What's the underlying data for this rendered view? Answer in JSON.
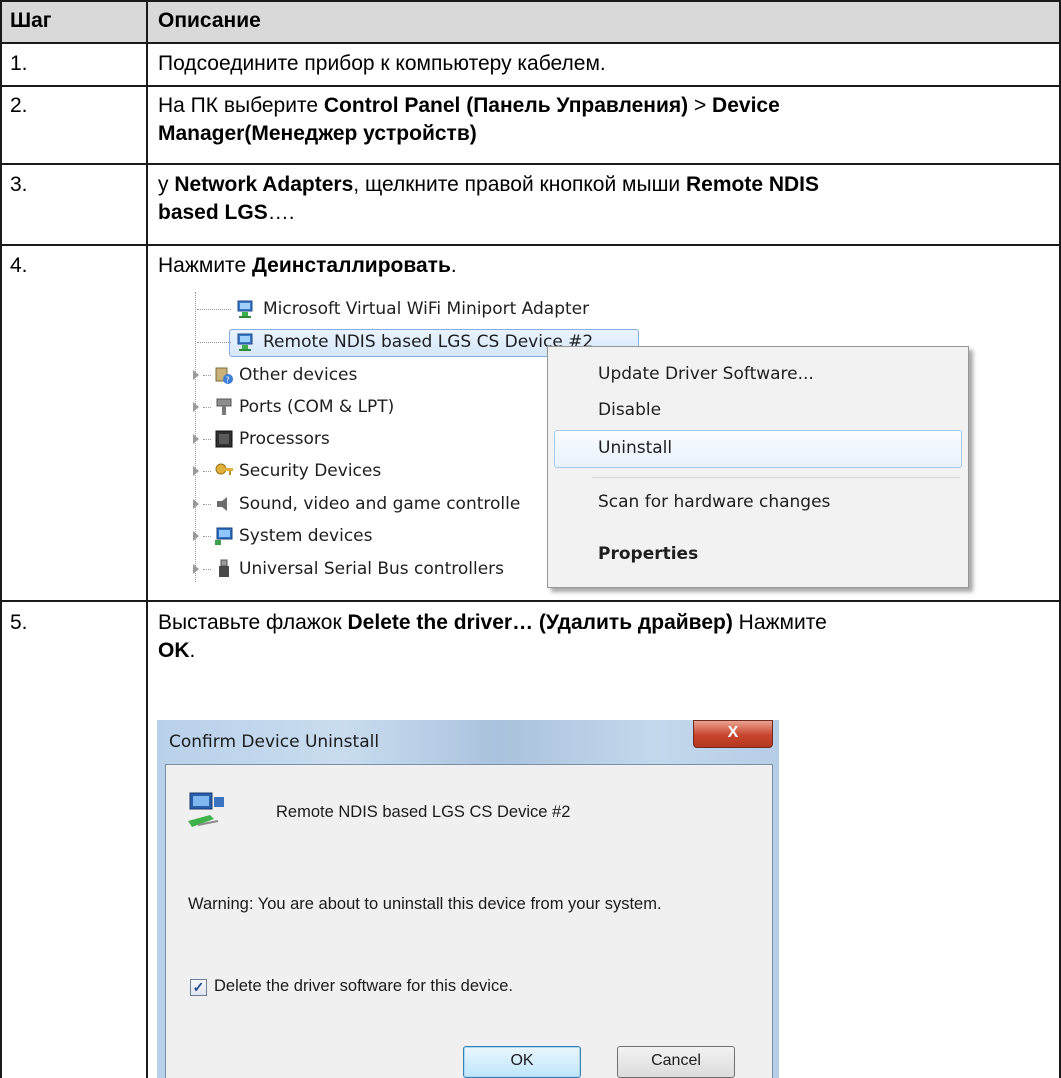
{
  "header": {
    "step": "Шаг",
    "description": "Описание"
  },
  "rows": [
    {
      "step": "1.",
      "text": "Подсоедините прибор к компьютеру кабелем."
    },
    {
      "step": "2.",
      "pre": "На ПК выберите ",
      "b1": "Control Panel (Панель Управления)",
      "mid": " > ",
      "b2": "Device",
      "line2_b": "Manager(Менеджер устройств)"
    },
    {
      "step": "3.",
      "pre": "у ",
      "b1": "Network Adapters",
      "mid": ", щелкните правой кнопкой мыши ",
      "b2": "Remote NDIS",
      "line2_b": "based LGS",
      "line2_tail": "…."
    },
    {
      "step": "4.",
      "pre": "Нажмите ",
      "b1": "Деинсталлировать",
      "tail": "."
    },
    {
      "step": "5.",
      "pre": "Выставьте флажок ",
      "b1": "Delete the driver… (Удалить драйвер)",
      "mid": " Нажмите",
      "line2_b": "OK",
      "line2_tail": "."
    }
  ],
  "device_manager": {
    "items": [
      "Microsoft Virtual WiFi Miniport Adapter",
      "Remote NDIS based LGS CS Device #2",
      "Other devices",
      "Ports (COM & LPT)",
      "Processors",
      "Security Devices",
      "Sound, video and game controlle",
      "System devices",
      "Universal Serial Bus controllers"
    ],
    "context_menu": [
      "Update Driver Software...",
      "Disable",
      "Uninstall",
      "Scan for hardware changes",
      "Properties"
    ]
  },
  "dialog": {
    "title": "Confirm Device Uninstall",
    "close": "X",
    "device": "Remote NDIS based LGS CS Device #2",
    "warning": "Warning: You are about to uninstall this device from your system.",
    "checkbox_label": "Delete the driver software for this device.",
    "checkbox_checked": true,
    "ok": "OK",
    "cancel": "Cancel"
  }
}
